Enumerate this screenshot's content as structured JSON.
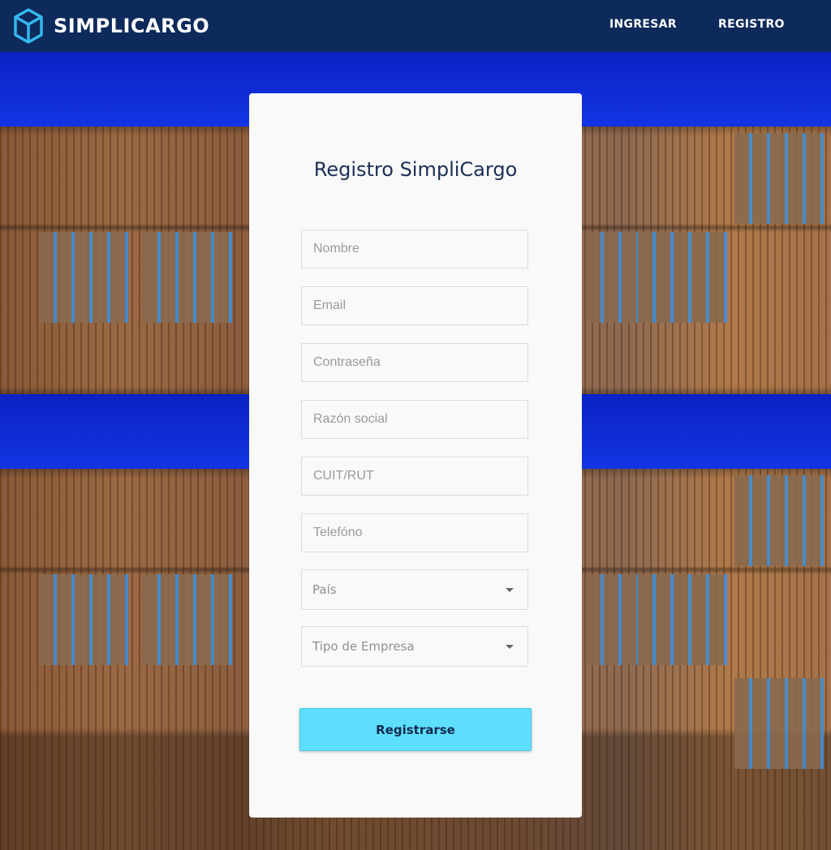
{
  "navbar": {
    "brand": "SIMPLICARGO",
    "logo_icon": "cube-icon",
    "links": [
      {
        "label": "INGRESAR"
      },
      {
        "label": "REGISTRO"
      }
    ]
  },
  "form": {
    "title": "Registro SimpliCargo",
    "fields": {
      "nombre": {
        "placeholder": "Nombre"
      },
      "email": {
        "placeholder": "Email"
      },
      "password": {
        "placeholder": "Contraseña"
      },
      "razon_social": {
        "placeholder": "Razón social"
      },
      "cuit": {
        "placeholder": "CUIT/RUT"
      },
      "telefono": {
        "placeholder": "Telefóno"
      }
    },
    "selects": {
      "pais": {
        "value": "País"
      },
      "tipo_empresa": {
        "value": "Tipo de Empresa"
      }
    },
    "submit_label": "Registrarse"
  },
  "colors": {
    "navbar": "#0e2a5a",
    "accent": "#5ddefd",
    "sky": "#1336e6"
  }
}
